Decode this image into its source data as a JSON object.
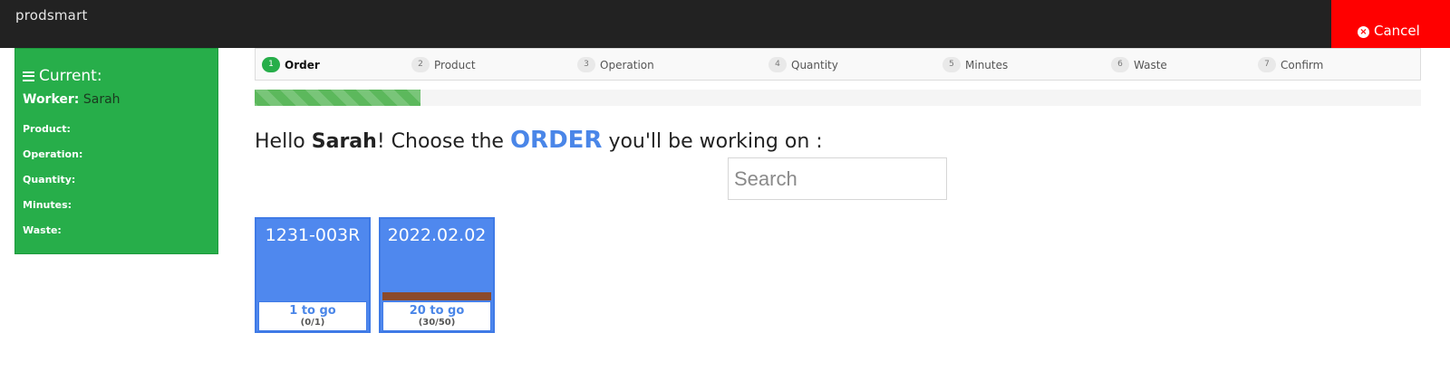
{
  "app": {
    "logo": "prodsmart"
  },
  "topbar": {
    "cancel_label": "Cancel",
    "cancel_icon": "times-circle-icon",
    "cancel_color": "#ff0000"
  },
  "sidebar": {
    "title": "Current:",
    "title_icon": "bars-icon",
    "worker_label": "Worker:",
    "worker_value": "Sarah",
    "fields": [
      "Product:",
      "Operation:",
      "Quantity:",
      "Minutes:",
      "Waste:"
    ],
    "color": "#27ae4a"
  },
  "steps": [
    {
      "num": "1",
      "label": "Order",
      "active": true
    },
    {
      "num": "2",
      "label": "Product",
      "active": false
    },
    {
      "num": "3",
      "label": "Operation",
      "active": false
    },
    {
      "num": "4",
      "label": "Quantity",
      "active": false
    },
    {
      "num": "5",
      "label": "Minutes",
      "active": false
    },
    {
      "num": "6",
      "label": "Waste",
      "active": false
    },
    {
      "num": "7",
      "label": "Confirm",
      "active": false
    }
  ],
  "progress": {
    "fraction": 0.142
  },
  "greeting": {
    "hello": "Hello ",
    "name": "Sarah",
    "mid": "! Choose the ",
    "entity": "ORDER",
    "end": " you'll be working on :"
  },
  "search": {
    "placeholder": "Search",
    "value": ""
  },
  "orders": [
    {
      "title": "1231-003R",
      "to_go": "1 to go",
      "count": "(0/1)",
      "progress_fraction": 0.0
    },
    {
      "title": "2022.02.02",
      "to_go": "20 to go",
      "count": "(30/50)",
      "progress_fraction": 0.6
    }
  ],
  "colors": {
    "accent_blue": "#4a86e8",
    "card_blue": "#4f88ee",
    "progress_brown": "#8b4a2b"
  }
}
